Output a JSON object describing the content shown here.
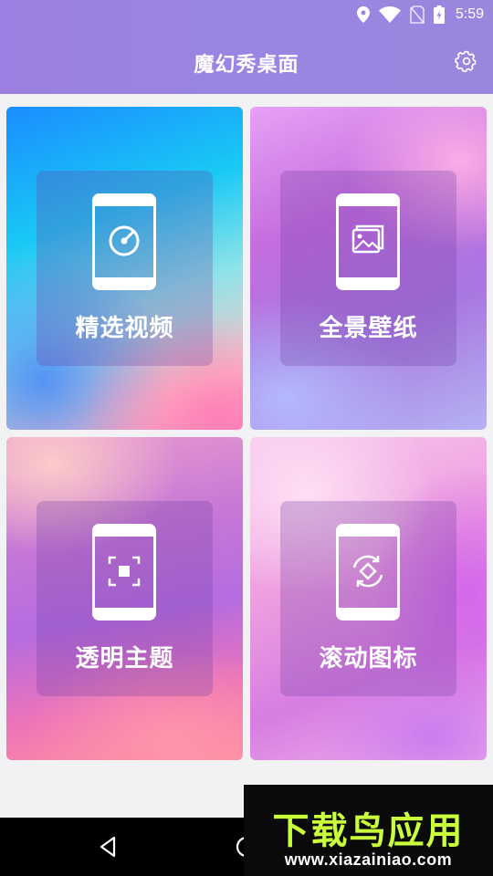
{
  "status_bar": {
    "time": "5:59",
    "icons": [
      "location-icon",
      "wifi-icon",
      "no-sim-icon",
      "battery-charging-icon"
    ]
  },
  "app_bar": {
    "title": "魔幻秀桌面",
    "settings_icon": "gear-icon"
  },
  "cards": [
    {
      "label": "精选视频",
      "icon": "video-dial-icon"
    },
    {
      "label": "全景壁纸",
      "icon": "picture-icon"
    },
    {
      "label": "透明主题",
      "icon": "focus-frame-icon"
    },
    {
      "label": "滚动图标",
      "icon": "rotate-diamond-icon"
    }
  ],
  "nav_bar": {
    "icons": [
      "back-icon",
      "home-icon"
    ]
  },
  "watermark": {
    "title": "下载鸟应用",
    "url": "www.xiazainiao.com"
  },
  "colors": {
    "app_bar": "#9a86e2",
    "background": "#f2f2f4",
    "watermark_text": "#c9ff3b"
  }
}
